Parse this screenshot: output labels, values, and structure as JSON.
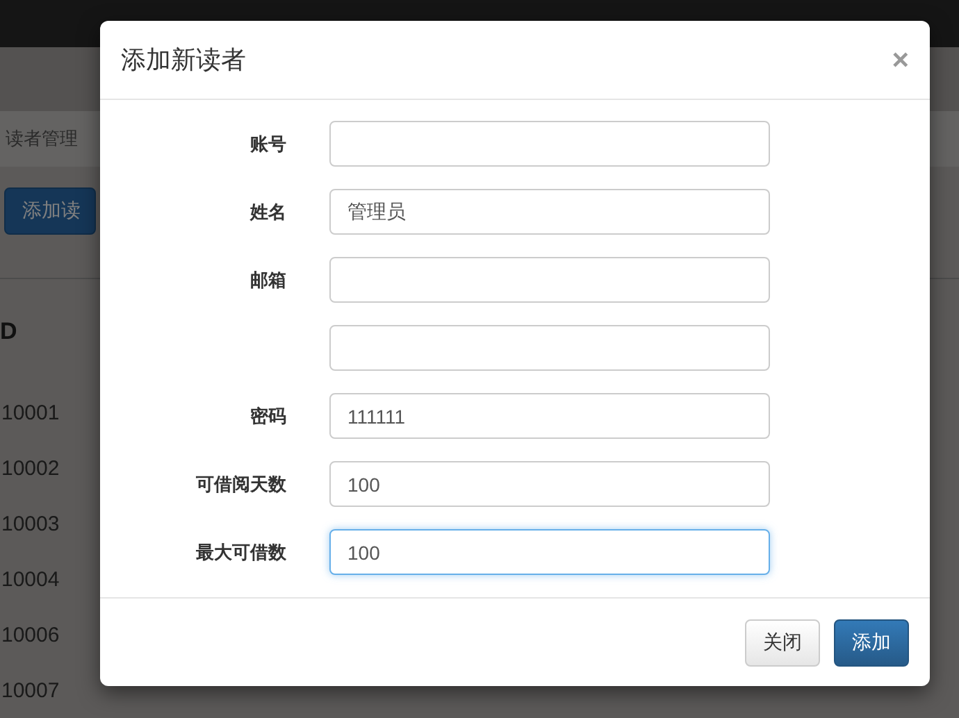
{
  "page": {
    "breadcrumb": "读者管理",
    "add_button": "添加读",
    "table": {
      "column_1": "D",
      "ids": [
        "10001",
        "10002",
        "10003",
        "10004",
        "10006",
        "10007"
      ]
    }
  },
  "modal": {
    "title": "添加新读者",
    "close": "×",
    "fields": [
      {
        "label": "账号",
        "focused": false
      },
      {
        "label": "姓名",
        "value": "管理员",
        "focused": false
      },
      {
        "label": "邮箱",
        "focused": false
      },
      {
        "focused": false
      },
      {
        "label": "密码",
        "value": "111111",
        "focused": false
      },
      {
        "label": "可借阅天数",
        "value": "100",
        "focused": false
      },
      {
        "label": "最大可借数",
        "value": "100",
        "focused": true
      }
    ],
    "buttons": [
      {
        "label": "关闭",
        "kind": "default"
      },
      {
        "label": "添加",
        "kind": "primary"
      }
    ]
  }
}
